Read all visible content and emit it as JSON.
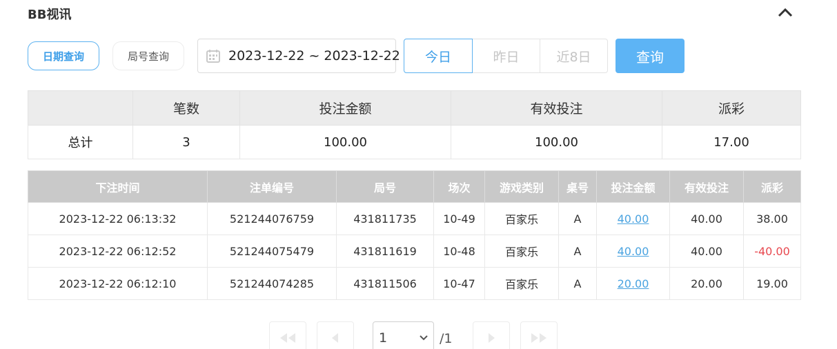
{
  "header": {
    "title": "BB视讯"
  },
  "filters": {
    "mode_date": "日期查询",
    "mode_round": "局号查询",
    "date_range": "2023-12-22 ~ 2023-12-22",
    "quick": [
      "今日",
      "昨日",
      "近8日"
    ],
    "query_button": "查询"
  },
  "summary": {
    "headers": [
      "",
      "笔数",
      "投注金额",
      "有效投注",
      "派彩"
    ],
    "row": {
      "label": "总计",
      "count": "3",
      "bet": "100.00",
      "valid": "100.00",
      "payout": "17.00"
    }
  },
  "detail": {
    "headers": [
      "下注时间",
      "注单编号",
      "局号",
      "场次",
      "游戏类别",
      "桌号",
      "投注金额",
      "有效投注",
      "派彩"
    ],
    "rows": [
      {
        "time": "2023-12-22 06:13:32",
        "order": "521244076759",
        "round": "431811735",
        "session": "10-49",
        "game": "百家乐",
        "table": "A",
        "bet": "40.00",
        "valid": "40.00",
        "payout": "38.00"
      },
      {
        "time": "2023-12-22 06:12:52",
        "order": "521244075479",
        "round": "431811619",
        "session": "10-48",
        "game": "百家乐",
        "table": "A",
        "bet": "40.00",
        "valid": "40.00",
        "payout": "-40.00"
      },
      {
        "time": "2023-12-22 06:12:10",
        "order": "521244074285",
        "round": "431811506",
        "session": "10-47",
        "game": "百家乐",
        "table": "A",
        "bet": "20.00",
        "valid": "20.00",
        "payout": "19.00"
      }
    ]
  },
  "pagination": {
    "current": "1",
    "total": "/1"
  },
  "colors": {
    "accent": "#5db4f5",
    "negative": "#e8484f",
    "header_bg": "#c9c9c9"
  }
}
